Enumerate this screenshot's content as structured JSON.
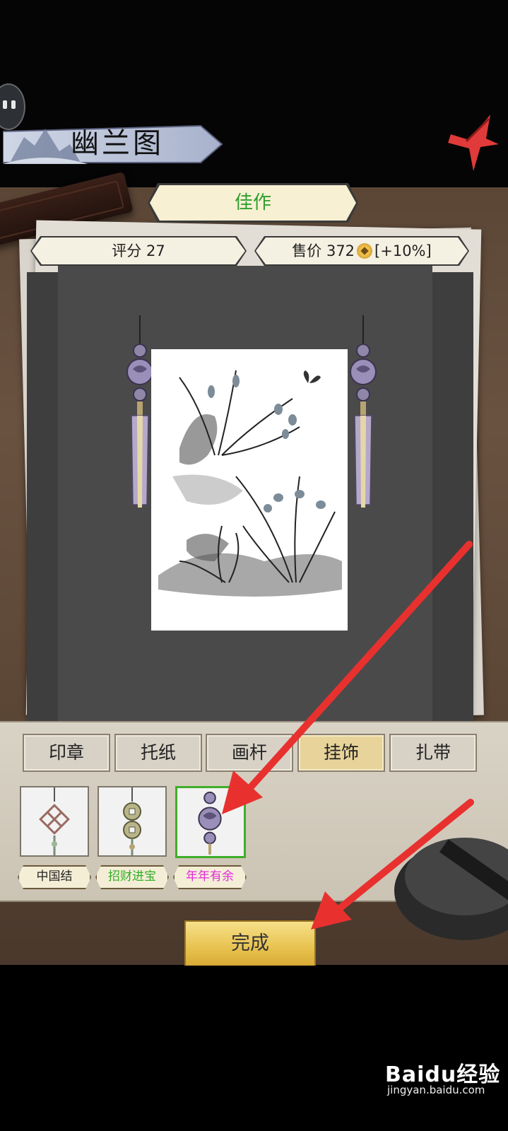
{
  "header": {
    "title": "幽兰图"
  },
  "rating": {
    "grade": "佳作",
    "score_text": "评分 27",
    "price_prefix": "售价 372",
    "price_bonus": "[+10%]"
  },
  "tabs": [
    {
      "label": "印章",
      "active": false
    },
    {
      "label": "托纸",
      "active": false
    },
    {
      "label": "画杆",
      "active": false
    },
    {
      "label": "挂饰",
      "active": true
    },
    {
      "label": "扎带",
      "active": false
    }
  ],
  "items": [
    {
      "label": "中国结",
      "label_color": "#222222",
      "icon": "chinese-knot-icon",
      "selected": false
    },
    {
      "label": "招财进宝",
      "label_color": "#2fae25",
      "icon": "coin-pendant-icon",
      "selected": false
    },
    {
      "label": "年年有余",
      "label_color": "#e02ad9",
      "icon": "fish-pendant-icon",
      "selected": true
    }
  ],
  "done_label": "完成",
  "watermark": {
    "brand": "Baidu经验",
    "url": "jingyan.baidu.com"
  },
  "colors": {
    "accent_green": "#2f9e2f",
    "arrow_red": "#e8312f",
    "gold": "#e8c24f"
  }
}
